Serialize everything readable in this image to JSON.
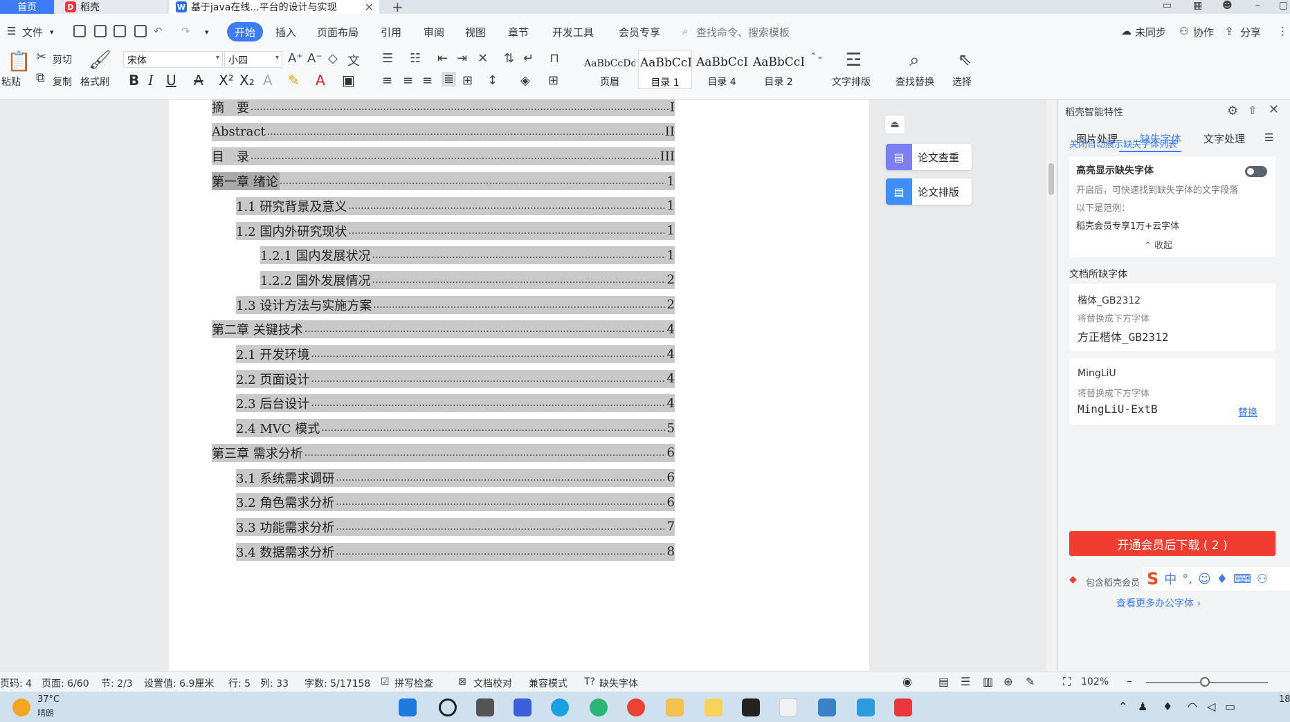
{
  "titlebar": {
    "tabs": [
      {
        "label": "首页"
      },
      {
        "label": "稻壳"
      },
      {
        "label": "基于java在线...平台的设计与实现"
      }
    ]
  },
  "menu": {
    "file": "文件",
    "items": [
      "开始",
      "插入",
      "页面布局",
      "引用",
      "审阅",
      "视图",
      "章节",
      "开发工具",
      "会员专享"
    ],
    "search_placeholder": "查找命令、搜索模板",
    "right": [
      "未同步",
      "协作",
      "分享"
    ]
  },
  "ribbon": {
    "paste": "粘贴",
    "cut": "剪切",
    "copy": "复制",
    "format_painter": "格式刷",
    "font_name": "宋体",
    "font_size": "小四",
    "styles": [
      {
        "sample": "AaBbCcDd",
        "name": "页眉"
      },
      {
        "sample": "AaBbCcDd",
        "name": "目录 1"
      },
      {
        "sample": "AaBbCcDd",
        "name": "目录 4"
      },
      {
        "sample": "AaBbCcDd",
        "name": "目录 2"
      }
    ],
    "text_layout": "文字排版",
    "find_replace": "查找替换",
    "select": "选择"
  },
  "toc": [
    {
      "title": "摘　要",
      "page": "I",
      "level": 0
    },
    {
      "title": "Abstract",
      "page": "II",
      "level": 0
    },
    {
      "title": "目　录",
      "page": "III",
      "level": 0
    },
    {
      "title": "第一章  绪论",
      "page": "1",
      "level": 0
    },
    {
      "title": "1.1  研究背景及意义",
      "page": "1",
      "level": 1
    },
    {
      "title": "1.2  国内外研究现状",
      "page": "1",
      "level": 1
    },
    {
      "title": "1.2.1  国内发展状况",
      "page": "1",
      "level": 2
    },
    {
      "title": "1.2.2  国外发展情况",
      "page": "2",
      "level": 2
    },
    {
      "title": "1.3  设计方法与实施方案",
      "page": "2",
      "level": 1
    },
    {
      "title": "第二章  关键技术",
      "page": "4",
      "level": 0
    },
    {
      "title": "2.1  开发环境",
      "page": "4",
      "level": 1
    },
    {
      "title": "2.2  页面设计",
      "page": "4",
      "level": 1
    },
    {
      "title": "2.3  后台设计",
      "page": "4",
      "level": 1
    },
    {
      "title": "2.4 MVC 模式",
      "page": "5",
      "level": 1
    },
    {
      "title": "第三章  需求分析",
      "page": "6",
      "level": 0
    },
    {
      "title": "3.1  系统需求调研",
      "page": "6",
      "level": 1
    },
    {
      "title": "3.2  角色需求分析",
      "page": "6",
      "level": 1
    },
    {
      "title": "3.3  功能需求分析",
      "page": "7",
      "level": 1
    },
    {
      "title": "3.4  数据需求分析",
      "page": "8",
      "level": 1
    }
  ],
  "float_buttons": {
    "check": "论文查重",
    "layout": "论文排版"
  },
  "panel": {
    "title": "稻壳智能特性",
    "tabs": [
      "图片处理",
      "缺失字体",
      "文字处理"
    ],
    "close_auto": "关闭自动展示缺失字体列表",
    "highlight_title": "高亮显示缺失字体",
    "highlight_desc": "开启后，可快速找到缺失字体的文字段落",
    "example_label": "以下是范例：",
    "example_text": "稻壳会员专享1万+云字体",
    "collapse": "收起",
    "missing_title": "文档所缺字体",
    "missing_fonts": [
      {
        "name": "楷体_GB2312",
        "hint": "将替换成下方字体",
        "replacement": "方正楷体_GB2312",
        "action": ""
      },
      {
        "name": "MingLiU",
        "hint": "将替换成下方字体",
        "replacement": "MingLiU-ExtB",
        "action": "替换"
      }
    ],
    "vip_button": "开通会员后下载 ( 2 )",
    "includes": "包含稻壳会员",
    "more_fonts": "查看更多办公字体"
  },
  "status": {
    "page_no": "页码: 4",
    "page": "页面: 6/60",
    "section": "节: 2/3",
    "setting": "设置值: 6.9厘米",
    "row": "行: 5",
    "col": "列: 33",
    "words": "字数: 5/17158",
    "spell": "拼写检查",
    "proof": "文档校对",
    "compat": "兼容模式",
    "missing_font": "缺失字体",
    "zoom": "102%"
  },
  "taskbar": {
    "weather_temp": "37°C",
    "weather_desc": "晴朗",
    "time": "18"
  },
  "colors": {
    "accent": "#3d7cf5",
    "vip": "#f03c31",
    "toc_hl": "#c9c9c9"
  }
}
